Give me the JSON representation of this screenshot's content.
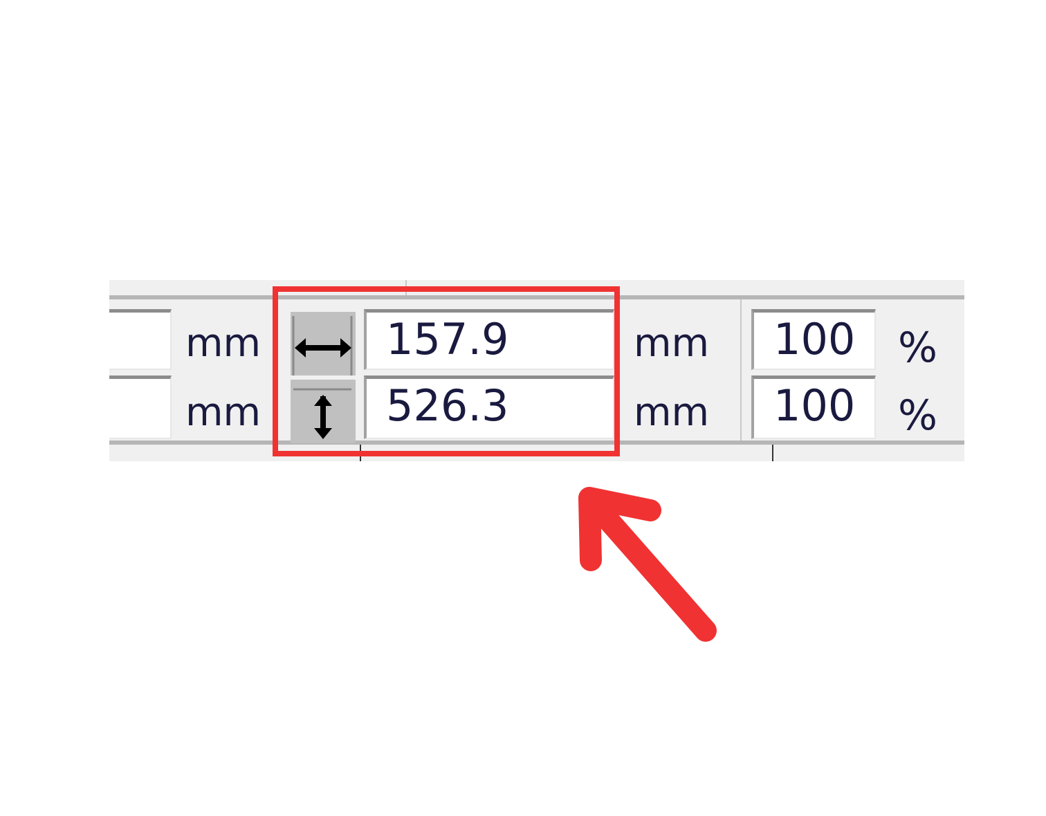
{
  "toolbar": {
    "width_row": {
      "value": "157.9",
      "unit": "mm",
      "scale": "100",
      "scale_unit": "%"
    },
    "height_row": {
      "value": "526.3",
      "unit": "mm",
      "scale": "100",
      "scale_unit": "%"
    },
    "left_units": [
      "mm",
      "mm"
    ],
    "width_icon": "horizontal-resize-icon",
    "height_icon": "vertical-resize-icon"
  },
  "annotation": {
    "highlight_color": "#f03232",
    "arrow_color": "#f03232"
  },
  "colors": {
    "toolbar_bg": "#f0f0f0",
    "field_bg": "#ffffff",
    "text": "#1a1a40",
    "icon_bg": "#c0c0c0"
  }
}
